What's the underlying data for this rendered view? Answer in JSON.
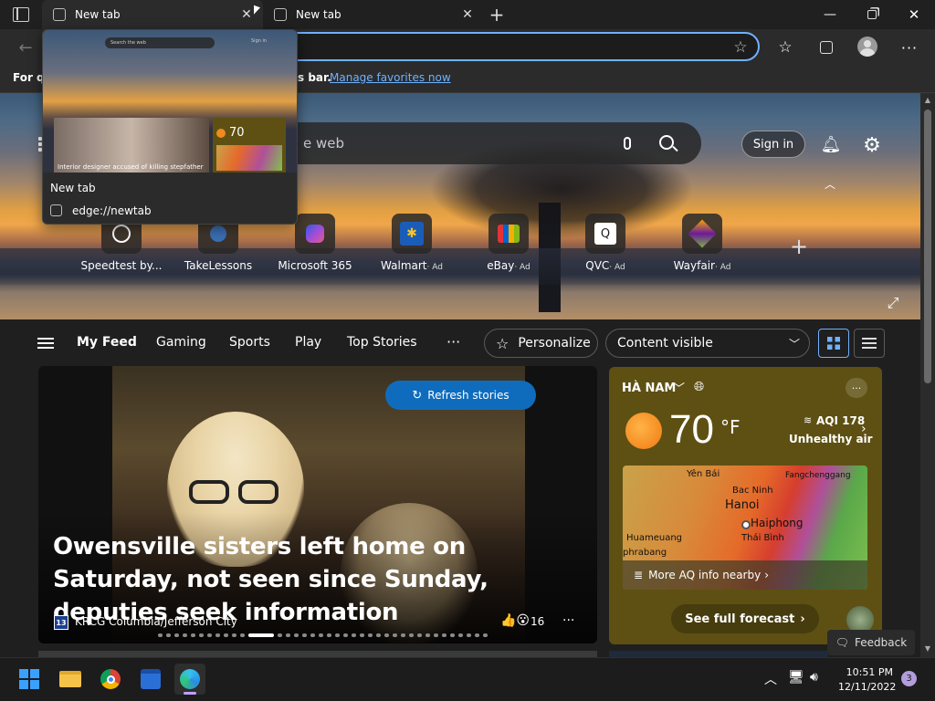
{
  "tabs": [
    {
      "title": "New tab",
      "active": true
    },
    {
      "title": "New tab",
      "active": false
    }
  ],
  "favorites_bar": {
    "prefix": "For qu",
    "suffix": "s bar.",
    "link": "Manage favorites now"
  },
  "preview": {
    "title": "New tab",
    "url": "edge://newtab",
    "thumb_search_placeholder": "Search the web",
    "thumb_sign_in": "Sign in",
    "thumb_temp": "70",
    "thumb_caption": "Interior designer accused of killing stepfather"
  },
  "hero": {
    "search_placeholder": "e web",
    "sign_in": "Sign in",
    "quick_links": [
      {
        "label": "Speedtest by...",
        "ad": ""
      },
      {
        "label": "TakeLessons",
        "ad": ""
      },
      {
        "label": "Microsoft 365",
        "ad": ""
      },
      {
        "label": "Walmart",
        "ad": "· Ad"
      },
      {
        "label": "eBay",
        "ad": "· Ad"
      },
      {
        "label": "QVC",
        "ad": "· Ad"
      },
      {
        "label": "Wayfair",
        "ad": "· Ad"
      }
    ]
  },
  "feed_nav": {
    "items": [
      "My Feed",
      "Gaming",
      "Sports",
      "Play",
      "Top Stories"
    ],
    "more": "···",
    "personalize": "Personalize",
    "content_visible": "Content visible"
  },
  "story": {
    "refresh": "Refresh stories",
    "headline": "Owensville sisters left home on Saturday, not seen since Sunday, deputies seek information",
    "source": "KRCG Columbia/Jefferson City",
    "reactions": "16"
  },
  "weather": {
    "location": "HÀ NAM",
    "temp": "70",
    "unit": "°F",
    "aqi": "AQI 178",
    "aqi_label": "Unhealthy air",
    "map_labels": [
      "Yên Bái",
      "Fangchenggang",
      "Bac Ninh",
      "Hanoi",
      "Haiphong",
      "Huameuang",
      "Thái Bình",
      "phrabang"
    ],
    "more_aq": "More AQ info nearby",
    "forecast": "See full forecast"
  },
  "feedback": "Feedback",
  "taskbar": {
    "time": "10:51 PM",
    "date": "12/11/2022",
    "badge": "3"
  },
  "colors": {
    "accent": "#0f6cbd",
    "link": "#6fb1ff",
    "weather_card": "#5e5013"
  }
}
